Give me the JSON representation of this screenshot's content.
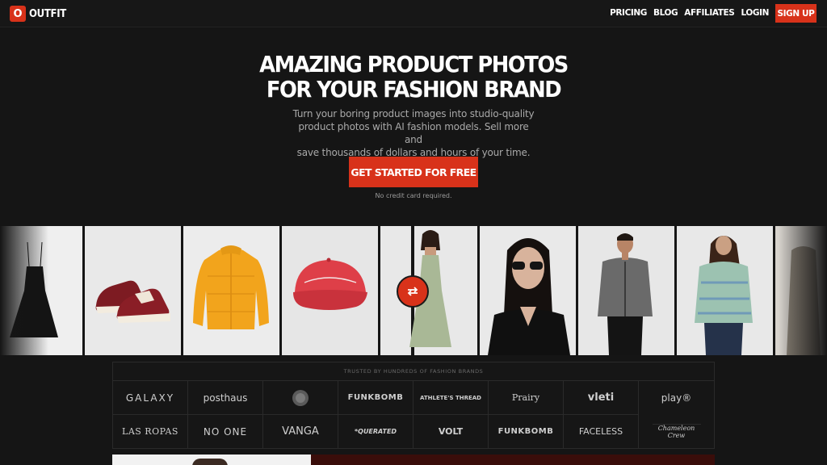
{
  "brand": {
    "mark": "O",
    "name": "OUTFIT"
  },
  "nav": {
    "links": [
      "PRICING",
      "BLOG",
      "AFFILIATES",
      "LOGIN"
    ],
    "signup_label": "SIGN UP"
  },
  "hero": {
    "title_line1": "AMAZING PRODUCT PHOTOS",
    "title_line2": "FOR YOUR FASHION BRAND",
    "subtitle_line1": "Turn your boring product images into studio-quality",
    "subtitle_line2": "product photos with AI fashion models. Sell more and",
    "subtitle_line3": "save thousands of dollars and hours of your time.",
    "cta_label": "GET STARTED FOR FREE",
    "cta_note": "No credit card required."
  },
  "colors": {
    "accent": "#d8321a",
    "background": "#151515"
  },
  "gallery": {
    "product_tiles": [
      "black-dress",
      "red-sneakers",
      "yellow-puffer-jacket",
      "red-cap"
    ],
    "model_tiles": [
      "model-green-dress",
      "model-sunglasses-blazer",
      "model-grey-jacket",
      "model-knit-sweater"
    ],
    "swap_icon": "swap-arrows-icon"
  },
  "brands": {
    "title": "TRUSTED BY HUNDREDS OF FASHION BRANDS",
    "row1": [
      "GALAXY",
      "posthaus",
      "",
      "FUNKBOMB",
      "ATHLETE'S THREAD",
      "Prairy",
      "vleti",
      "play®"
    ],
    "row2": [
      "LAS ROPAS",
      "NO ONE",
      "VANGA",
      "*QUERATED",
      "VOLT",
      "FUNKBOMB",
      "FACELESS",
      "Chameleon Crew"
    ]
  }
}
